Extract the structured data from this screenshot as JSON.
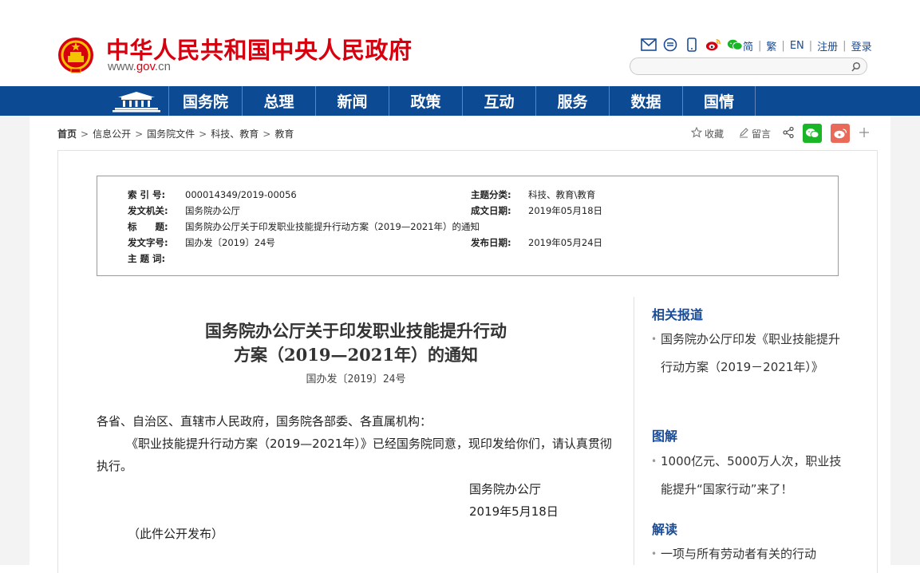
{
  "header": {
    "site_title": "中华人民共和国中央人民政府",
    "domain_prefix": "www.",
    "domain_main": "gov",
    "domain_suffix": ".cn",
    "share_icons": [
      "mail-icon",
      "rss-icon",
      "mobile-icon",
      "weibo-icon",
      "wechat-icon"
    ],
    "links": [
      "简",
      "繁",
      "EN",
      "注册",
      "登录"
    ],
    "search_placeholder": ""
  },
  "nav": {
    "items": [
      "国务院",
      "总理",
      "新闻",
      "政策",
      "互动",
      "服务",
      "数据",
      "国情"
    ]
  },
  "breadcrumb": {
    "items": [
      "首页",
      "信息公开",
      "国务院文件",
      "科技、教育",
      "教育"
    ]
  },
  "tools": {
    "favorite": "收藏",
    "comment": "留言"
  },
  "meta": {
    "index_label": "索 引 号:",
    "index_value": "000014349/2019-00056",
    "category_label": "主题分类:",
    "category_value": "科技、教育\\教育",
    "issuer_label": "发文机关:",
    "issuer_value": "国务院办公厅",
    "created_label": "成文日期:",
    "created_value": "2019年05月18日",
    "title_label": "标　　题:",
    "title_value": "国务院办公厅关于印发职业技能提升行动方案（2019—2021年）的通知",
    "docno_label": "发文字号:",
    "docno_value": "国办发〔2019〕24号",
    "published_label": "发布日期:",
    "published_value": "2019年05月24日",
    "keywords_label": "主 题 词:",
    "keywords_value": ""
  },
  "article": {
    "title_line1": "国务院办公厅关于印发职业技能提升行动",
    "title_line2": "方案（2019—2021年）的通知",
    "doc_number": "国办发〔2019〕24号",
    "salutation": "各省、自治区、直辖市人民政府，国务院各部委、各直属机构：",
    "body": "《职业技能提升行动方案（2019—2021年）》已经国务院同意，现印发给你们，请认真贯彻执行。",
    "signature_org": "国务院办公厅",
    "signature_date": "2019年5月18日",
    "footnote": "（此件公开发布）"
  },
  "sidebar": {
    "related_heading": "相关报道",
    "related_item": "国务院办公厅印发《职业技能提升行动方案（2019－2021年）》",
    "diagram_heading": "图解",
    "diagram_item": "1000亿元、5000万人次，职业技能提升“国家行动”来了！",
    "reading_heading": "解读",
    "reading_item": "一项与所有劳动者有关的行动"
  },
  "colors": {
    "brand_red": "#d7000f",
    "nav_blue": "#0d4a94",
    "link_blue": "#1a4c96",
    "wechat_green": "#1ab627",
    "weibo_red": "#ea6a5a"
  }
}
